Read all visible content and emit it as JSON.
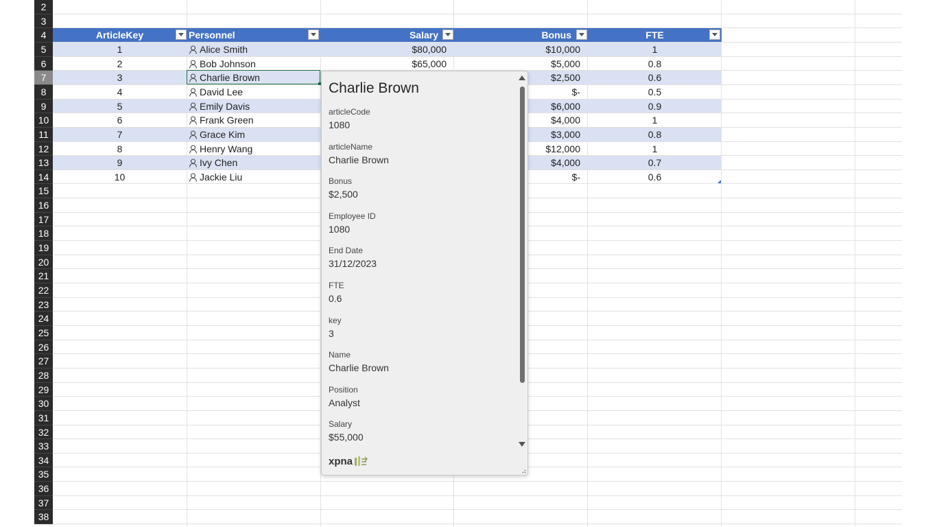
{
  "sheet": {
    "row_numbers": [
      "2",
      "3",
      "4",
      "5",
      "6",
      "7",
      "8",
      "9",
      "10",
      "11",
      "12",
      "13",
      "14",
      "15",
      "16",
      "17",
      "18",
      "19",
      "20",
      "21",
      "22",
      "23",
      "24",
      "25",
      "26",
      "27",
      "28",
      "29",
      "30",
      "31",
      "32",
      "33",
      "34",
      "35",
      "36",
      "37",
      "38"
    ],
    "selected_row": "7"
  },
  "table": {
    "headers": [
      "ArticleKey",
      "Personnel",
      "Salary",
      "Bonus",
      "FTE"
    ],
    "rows": [
      {
        "key": "1",
        "name": "Alice Smith",
        "salary": "$80,000",
        "bonus": "$10,000",
        "fte": "1"
      },
      {
        "key": "2",
        "name": "Bob Johnson",
        "salary": "$65,000",
        "bonus": "$5,000",
        "fte": "0.8"
      },
      {
        "key": "3",
        "name": "Charlie Brown",
        "salary": "",
        "bonus": "$2,500",
        "fte": "0.6"
      },
      {
        "key": "4",
        "name": "David Lee",
        "salary": "",
        "bonus": "$-",
        "fte": "0.5"
      },
      {
        "key": "5",
        "name": "Emily Davis",
        "salary": "",
        "bonus": "$6,000",
        "fte": "0.9"
      },
      {
        "key": "6",
        "name": "Frank Green",
        "salary": "",
        "bonus": "$4,000",
        "fte": "1"
      },
      {
        "key": "7",
        "name": "Grace Kim",
        "salary": "",
        "bonus": "$3,000",
        "fte": "0.8"
      },
      {
        "key": "8",
        "name": "Henry Wang",
        "salary": "",
        "bonus": "$12,000",
        "fte": "1"
      },
      {
        "key": "9",
        "name": "Ivy Chen",
        "salary": "",
        "bonus": "$4,000",
        "fte": "0.7"
      },
      {
        "key": "10",
        "name": "Jackie Liu",
        "salary": "",
        "bonus": "$-",
        "fte": "0.6"
      }
    ],
    "header_color": "#4472c4",
    "band_color": "#d9e1f2"
  },
  "card": {
    "title": "Charlie Brown",
    "fields": [
      {
        "label": "articleCode",
        "value": "1080"
      },
      {
        "label": "articleName",
        "value": "Charlie Brown"
      },
      {
        "label": "Bonus",
        "value": "$2,500"
      },
      {
        "label": "Employee ID",
        "value": "1080"
      },
      {
        "label": "End Date",
        "value": "31/12/2023"
      },
      {
        "label": "FTE",
        "value": "0.6"
      },
      {
        "label": "key",
        "value": "3"
      },
      {
        "label": "Name",
        "value": "Charlie Brown"
      },
      {
        "label": "Position",
        "value": "Analyst"
      },
      {
        "label": "Salary",
        "value": "$55,000"
      }
    ],
    "brand": "xpna",
    "icons": [
      "person-icon",
      "scroll-up-icon",
      "scroll-down-icon",
      "xpna-logo-icon",
      "resize-grip-icon"
    ]
  }
}
